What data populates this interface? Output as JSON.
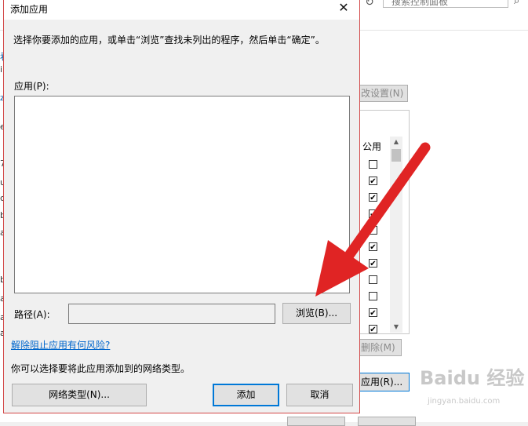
{
  "background": {
    "search_placeholder": "搜索控制面板",
    "change_settings_label": "改设置(N)",
    "list_header_public": "公用",
    "public_checks": [
      false,
      true,
      true,
      true,
      false,
      true,
      true,
      false,
      false,
      true,
      true
    ],
    "remove_label": "删除(M)",
    "allow_app_label": "应用(R)...",
    "left_fragments": [
      "看",
      "i",
      "z",
      "e",
      "7",
      "u",
      "c",
      "b",
      "a",
      "b",
      "a",
      "a",
      "a"
    ],
    "watermark": "Baidu 经验",
    "watermark_sub": "jingyan.baidu.com"
  },
  "dialog": {
    "title": "添加应用",
    "instruction": "选择你要添加的应用，或单击“浏览”查找未列出的程序，然后单击“确定”。",
    "apps_label": "应用(P):",
    "path_label": "路径(A):",
    "path_value": "",
    "browse_label": "浏览(B)...",
    "risk_link": "解除阻止应用有何风险?",
    "network_hint": "你可以选择要将此应用添加到的网络类型。",
    "network_types_label": "网络类型(N)...",
    "add_label": "添加",
    "cancel_label": "取消"
  },
  "colors": {
    "arrow": "#e02424",
    "dialog_border": "#d24747",
    "accent": "#0078d7",
    "link": "#0066cc"
  }
}
